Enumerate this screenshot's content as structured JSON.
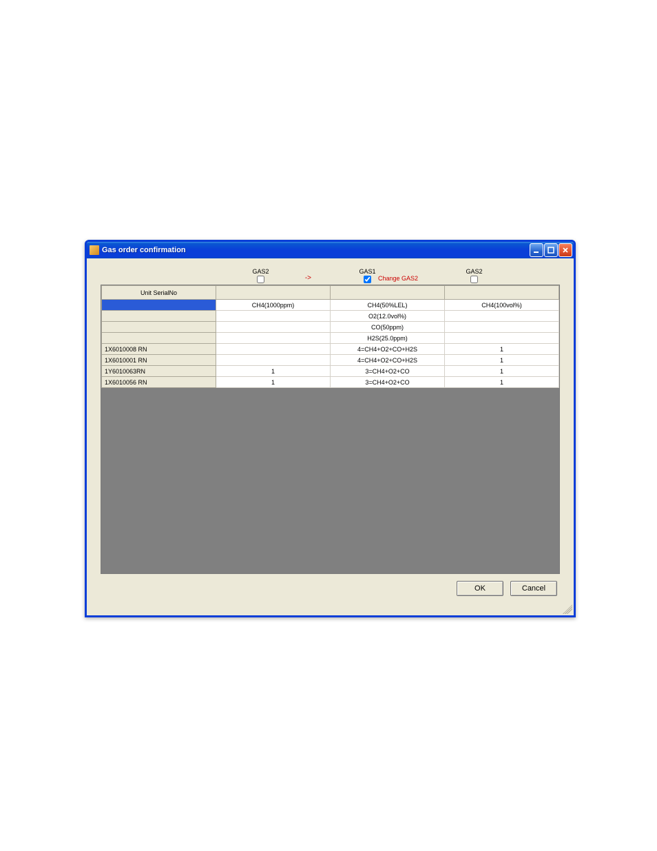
{
  "window": {
    "title": "Gas order confirmation"
  },
  "header": {
    "gas2a_label": "GAS2",
    "gas2a_checked": false,
    "arrow": "->",
    "gas1_label": "GAS1",
    "gas1_checked": true,
    "change_text": "Change GAS2",
    "gas2b_label": "GAS2",
    "gas2b_checked": false
  },
  "columns": {
    "serial": "Unit SerialNo",
    "c1": "",
    "c2": "",
    "c3": ""
  },
  "rows": [
    {
      "serial": "",
      "selected": true,
      "c1": "CH4(1000ppm)",
      "c2": "CH4(50%LEL)",
      "c3": "CH4(100vol%)"
    },
    {
      "serial": "",
      "c1": "",
      "c2": "O2(12.0vol%)",
      "c3": ""
    },
    {
      "serial": "",
      "c1": "",
      "c2": "CO(50ppm)",
      "c3": ""
    },
    {
      "serial": "",
      "c1": "",
      "c2": "H2S(25.0ppm)",
      "c3": ""
    },
    {
      "serial": "1X6010008 RN",
      "c1": "",
      "c2": "4=CH4+O2+CO+H2S",
      "c3": "1"
    },
    {
      "serial": "1X6010001 RN",
      "c1": "",
      "c2": "4=CH4+O2+CO+H2S",
      "c3": "1"
    },
    {
      "serial": "1Y6010063RN",
      "c1": "1",
      "c2": "3=CH4+O2+CO",
      "c3": "1"
    },
    {
      "serial": "1X6010056 RN",
      "c1": "1",
      "c2": "3=CH4+O2+CO",
      "c3": "1"
    }
  ],
  "buttons": {
    "ok": "OK",
    "cancel": "Cancel"
  }
}
